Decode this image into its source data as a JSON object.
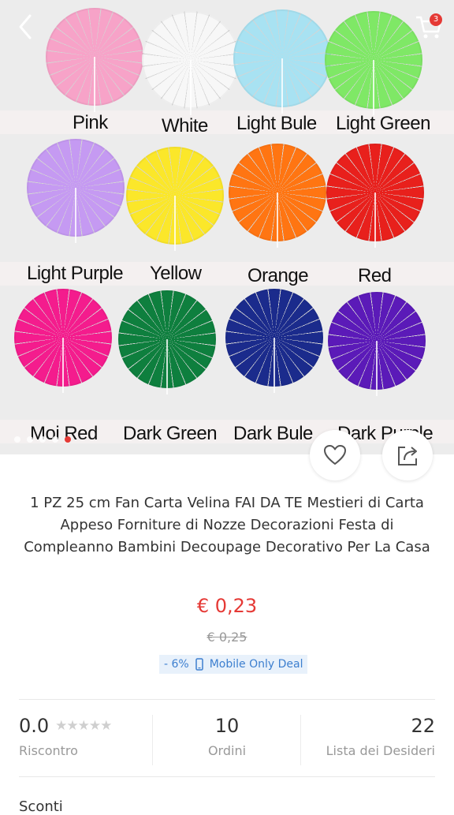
{
  "header": {
    "back_icon": "chevron-left-icon",
    "cart_icon": "cart-icon",
    "cart_count": "3"
  },
  "gallery": {
    "colors": [
      {
        "label": "Pink",
        "hex": "#f7a3c8"
      },
      {
        "label": "White",
        "hex": "#f7f7f7"
      },
      {
        "label": "Light Bule",
        "hex": "#a8e2f2"
      },
      {
        "label": "Light Green",
        "hex": "#7fe866"
      },
      {
        "label": "Light Purple",
        "hex": "#c59af2"
      },
      {
        "label": "Yellow",
        "hex": "#fbe72a"
      },
      {
        "label": "Orange",
        "hex": "#ff7512"
      },
      {
        "label": "Red",
        "hex": "#e8201c"
      },
      {
        "label": "Moi Red",
        "hex": "#f41c8d"
      },
      {
        "label": "Dark Green",
        "hex": "#0e7f3e"
      },
      {
        "label": "Dark Bule",
        "hex": "#1b2b8c"
      },
      {
        "label": "Dark Purple",
        "hex": "#5b1ab8"
      }
    ],
    "active_dot_index": 4,
    "dot_count": 5
  },
  "actions": {
    "wishlist_icon": "heart-icon",
    "share_icon": "share-icon"
  },
  "product": {
    "title": "1 PZ 25 cm Fan Carta Velina FAI DA TE Mestieri di Carta Appeso Forniture di Nozze Decorazioni Festa di Compleanno Bambini Decoupage Decorativo Per La Casa",
    "price": "€ 0,23",
    "old_price": "€ 0,25",
    "discount": "- 6%",
    "deal_label": "Mobile Only Deal",
    "deal_icon": "mobile-phone-icon"
  },
  "stats": {
    "rating_value": "0.0",
    "rating_stars": "★★★★★",
    "rating_label": "Riscontro",
    "orders_value": "10",
    "orders_label": "Ordini",
    "wishlist_value": "22",
    "wishlist_label": "Lista dei Desideri"
  },
  "sections": {
    "discounts_label": "Sconti"
  },
  "accent_color": "#e53935"
}
